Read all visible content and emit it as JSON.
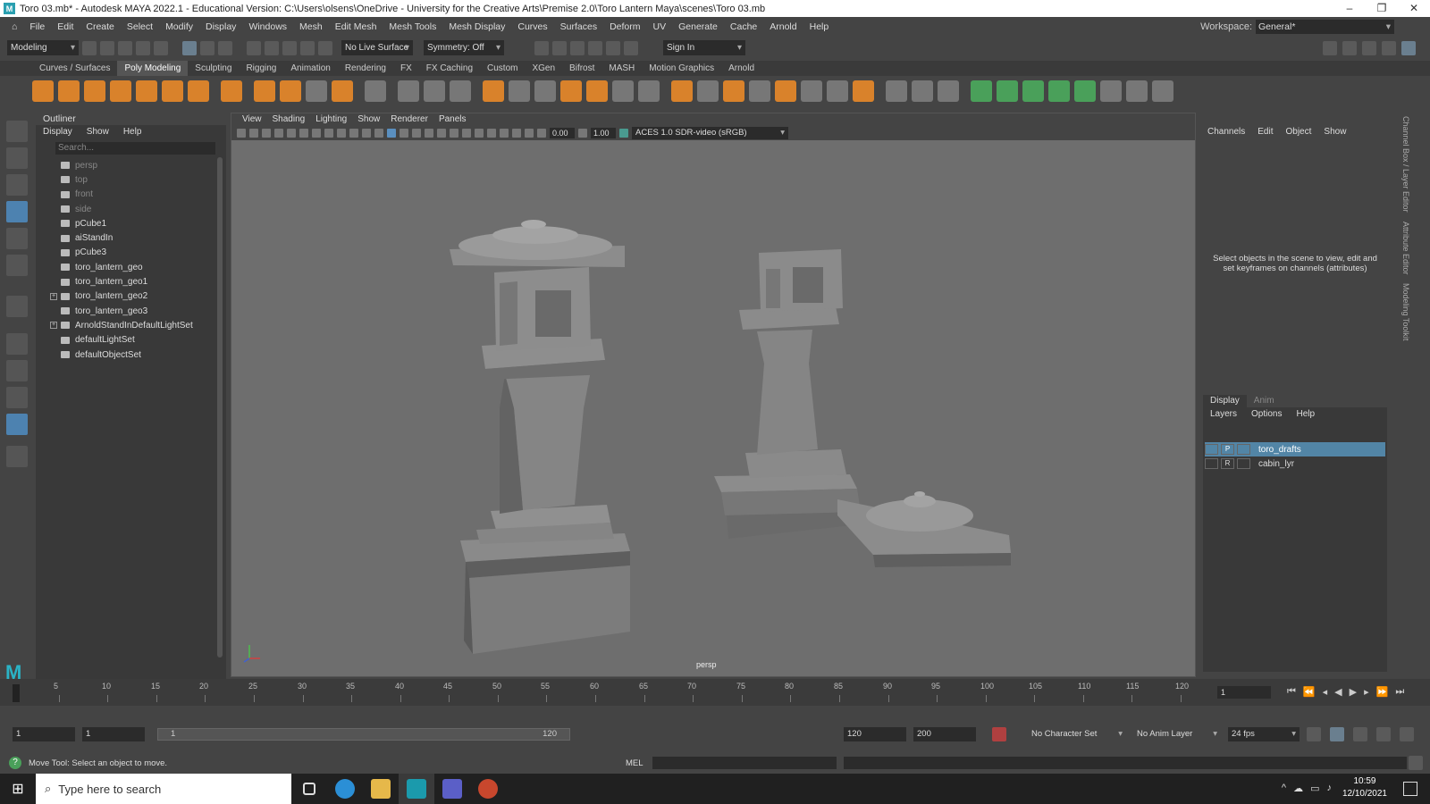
{
  "title": "Toro 03.mb* - Autodesk MAYA 2022.1 - Educational Version: C:\\Users\\olsens\\OneDrive - University for the Creative Arts\\Premise 2.0\\Toro Lantern Maya\\scenes\\Toro 03.mb",
  "menu": [
    "File",
    "Edit",
    "Create",
    "Select",
    "Modify",
    "Display",
    "Windows",
    "Mesh",
    "Edit Mesh",
    "Mesh Tools",
    "Mesh Display",
    "Curves",
    "Surfaces",
    "Deform",
    "UV",
    "Generate",
    "Cache",
    "Arnold",
    "Help"
  ],
  "workspace": {
    "label": "Workspace:",
    "value": "General*"
  },
  "statusline": {
    "mode": "Modeling",
    "live_surface": "No Live Surface",
    "symmetry": "Symmetry: Off",
    "sign_in": "Sign In"
  },
  "shelf_tabs": [
    "Curves / Surfaces",
    "Poly Modeling",
    "Sculpting",
    "Rigging",
    "Animation",
    "Rendering",
    "FX",
    "FX Caching",
    "Custom",
    "XGen",
    "Bifrost",
    "MASH",
    "Motion Graphics",
    "Arnold"
  ],
  "active_shelf_tab": "Poly Modeling",
  "outliner": {
    "title": "Outliner",
    "menu": [
      "Display",
      "Show",
      "Help"
    ],
    "search_placeholder": "Search...",
    "items": [
      "persp",
      "top",
      "front",
      "side",
      "pCube1",
      "aiStandIn",
      "pCube3",
      "toro_lantern_geo",
      "toro_lantern_geo1",
      "toro_lantern_geo2",
      "toro_lantern_geo3",
      "ArnoldStandInDefaultLightSet",
      "defaultLightSet",
      "defaultObjectSet"
    ]
  },
  "viewport": {
    "menu": [
      "View",
      "Shading",
      "Lighting",
      "Show",
      "Renderer",
      "Panels"
    ],
    "val1": "0.00",
    "val2": "1.00",
    "colorspace": "ACES 1.0 SDR-video (sRGB)",
    "camera": "persp"
  },
  "channelbox": {
    "tabs": [
      "Channels",
      "Edit",
      "Object",
      "Show"
    ],
    "message": "Select objects in the scene to view, edit and set keyframes on channels (attributes)"
  },
  "layer_editor": {
    "tabs": [
      "Display",
      "Anim"
    ],
    "menu": [
      "Layers",
      "Options",
      "Help"
    ],
    "layers": [
      {
        "name": "toro_drafts",
        "flag": "P"
      },
      {
        "name": "cabin_lyr",
        "flag": "R"
      }
    ]
  },
  "side_tabs": [
    "Channel Box / Layer Editor",
    "Attribute Editor",
    "Modeling Toolkit"
  ],
  "timeline": {
    "ticks": [
      "5",
      "10",
      "15",
      "20",
      "25",
      "30",
      "35",
      "40",
      "45",
      "50",
      "55",
      "60",
      "65",
      "70",
      "75",
      "80",
      "85",
      "90",
      "95",
      "100",
      "105",
      "110",
      "115",
      "120"
    ],
    "current_frame": "1"
  },
  "range": {
    "start": "1",
    "playback_start": "1",
    "range_left": "1",
    "range_right": "120",
    "playback_end": "120",
    "end": "200",
    "character_set": "No Character Set",
    "anim_layer": "No Anim Layer",
    "fps": "24 fps"
  },
  "helpline": "Move Tool: Select an object to move.",
  "cmd_label": "MEL",
  "taskbar": {
    "search": "Type here to search",
    "time": "10:59",
    "date": "12/10/2021"
  }
}
